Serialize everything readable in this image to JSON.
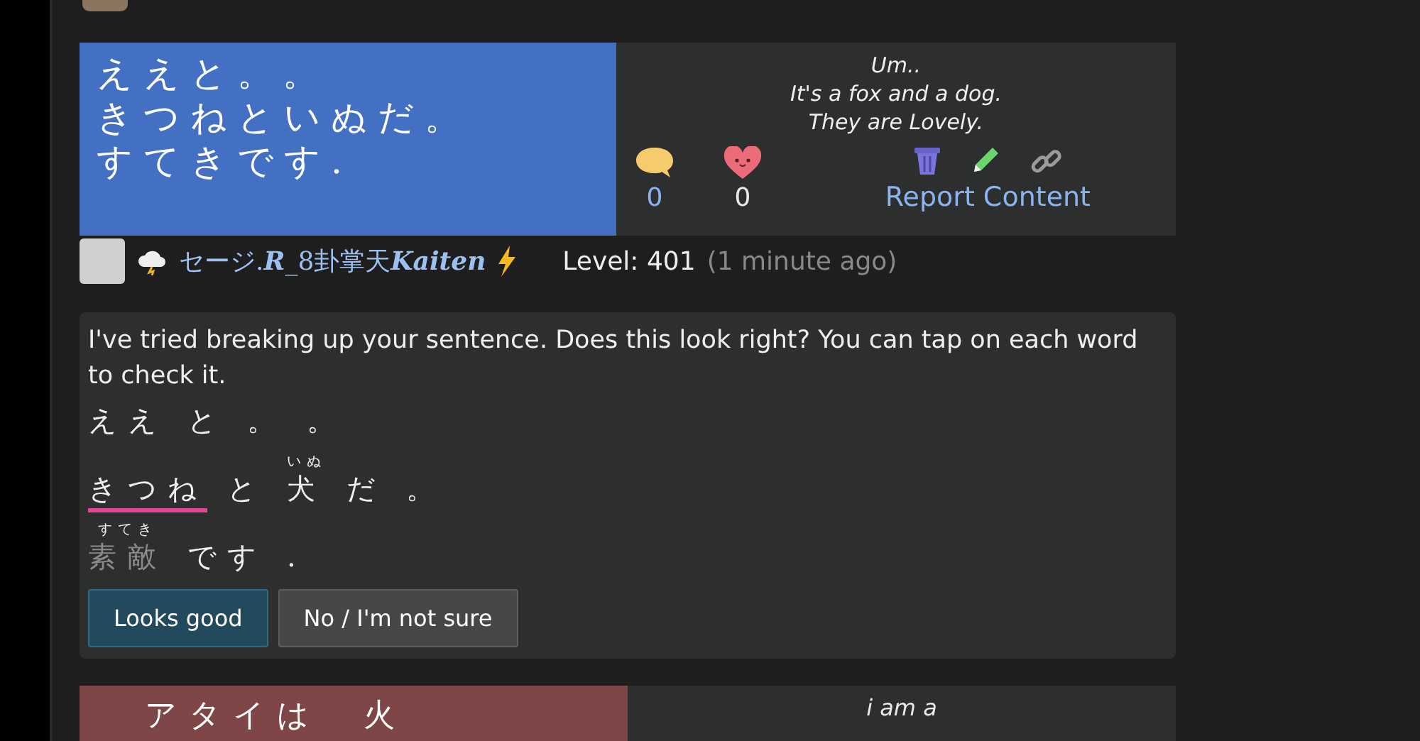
{
  "posts": [
    {
      "sentence_lines": [
        "ええと。。",
        "きつねといぬだ。",
        "すてきです."
      ],
      "translation_lines": [
        "Um..",
        "It's a fox and a dog.",
        "They are Lovely."
      ],
      "comment_count": "0",
      "like_count": "0",
      "report_link": "Report Content"
    }
  ],
  "comment": {
    "username": "セージ.**R**_8卦掌天**Kaiten**",
    "level": "Level: 401",
    "time": "(1 minute ago)"
  },
  "breakdown": {
    "intro": "I've tried breaking up your sentence. Does this look right? You can tap on each word to check it.",
    "lines": [
      [
        {
          "text": "ええ",
          "selected": false,
          "muted": false
        },
        {
          "text": "と",
          "selected": false,
          "muted": false
        },
        {
          "text": "。",
          "selected": false,
          "muted": false
        },
        {
          "text": "。",
          "selected": false,
          "muted": false
        }
      ],
      [
        {
          "text": "きつね",
          "selected": true,
          "muted": false
        },
        {
          "text": "と",
          "selected": false,
          "muted": false
        },
        {
          "text": "犬",
          "reading": "いぬ",
          "selected": false,
          "muted": false
        },
        {
          "text": "だ",
          "selected": false,
          "muted": false
        },
        {
          "text": "。",
          "selected": false,
          "muted": false
        }
      ],
      [
        {
          "text": "素敵",
          "reading": "すてき",
          "selected": false,
          "muted": true
        },
        {
          "text": "です",
          "selected": false,
          "muted": false
        },
        {
          "text": ".",
          "selected": false,
          "muted": false
        }
      ]
    ],
    "buttons": [
      {
        "label": "Looks good",
        "kind": "primary"
      },
      {
        "label": "No / I'm not sure",
        "kind": "secondary"
      }
    ]
  },
  "next_post": {
    "sentence": "アタイは　火",
    "translation": "i am a"
  }
}
